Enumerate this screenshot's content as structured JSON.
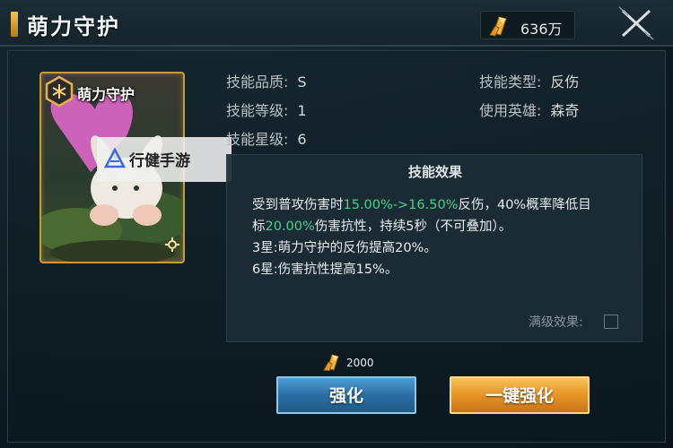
{
  "header": {
    "title": "萌力守护",
    "currency_value": "636万"
  },
  "card": {
    "name": "萌力守护"
  },
  "watermark": {
    "text": "行健手游"
  },
  "info": {
    "quality_label": "技能品质:",
    "quality_value": "S",
    "level_label": "技能等级:",
    "level_value": "1",
    "star_label": "技能星级:",
    "star_value": "6",
    "type_label": "技能类型:",
    "type_value": "反伤",
    "hero_label": "使用英雄:",
    "hero_value": "森奇"
  },
  "effect": {
    "title": "技能效果",
    "line1_a": "受到普攻伤害时",
    "line1_green": "15.00%->16.50%",
    "line1_b": "反伤，40%概率降低目",
    "line2_a": "标",
    "line2_green": "20.00%",
    "line2_b": "伤害抗性，持续5秒（不可叠加）。",
    "line3": "3星:萌力守护的反伤提高20%。",
    "line4": "6星:伤害抗性提高15%。",
    "max_level_label": "满级效果:",
    "highlight_color": "#4bd08a"
  },
  "cost": {
    "value": "2000"
  },
  "buttons": {
    "enhance": "强化",
    "one_key_enhance": "一键强化"
  }
}
